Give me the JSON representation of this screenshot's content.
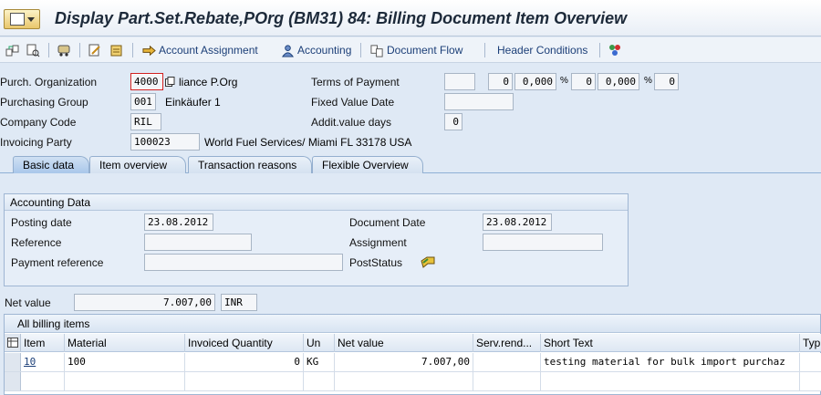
{
  "window": {
    "title": "Display Part.Set.Rebate,POrg (BM31) 84: Billing Document Item Overview"
  },
  "toolbar": {
    "account_assignment": "Account Assignment",
    "accounting": "Accounting",
    "document_flow": "Document Flow",
    "header_conditions": "Header Conditions"
  },
  "header": {
    "purch_org_label": "Purch. Organization",
    "purch_org_value": "4000",
    "purch_org_text": "liance  P.Org",
    "purch_group_label": "Purchasing Group",
    "purch_group_value": "001",
    "purch_group_text": "Einkäufer 1",
    "company_code_label": "Company Code",
    "company_code_value": "RIL",
    "invoicing_party_label": "Invoicing Party",
    "invoicing_party_value": "100023",
    "invoicing_party_text": "World Fuel Services/ Miami FL  33178 USA",
    "terms_label": "Terms of Payment",
    "terms_value": "",
    "terms_days1": "0",
    "terms_pct1": "0,000",
    "terms_days2": "0",
    "terms_pct2": "0,000",
    "terms_days3": "0",
    "pct_sign": "%",
    "fixed_value_date_label": "Fixed Value Date",
    "fixed_value_date_value": "",
    "addit_value_days_label": "Addit.value days",
    "addit_value_days_value": "0"
  },
  "tabs": [
    {
      "label": "Basic data",
      "active": true
    },
    {
      "label": "Item overview",
      "active": false
    },
    {
      "label": "Transaction reasons",
      "active": false
    },
    {
      "label": "Flexible Overview",
      "active": false
    }
  ],
  "accounting": {
    "title": "Accounting Data",
    "posting_date_label": "Posting date",
    "posting_date_value": "23.08.2012",
    "document_date_label": "Document Date",
    "document_date_value": "23.08.2012",
    "reference_label": "Reference",
    "reference_value": "",
    "assignment_label": "Assignment",
    "assignment_value": "",
    "payment_reference_label": "Payment reference",
    "payment_reference_value": "",
    "post_status_label": "PostStatus"
  },
  "net_value": {
    "label": "Net value",
    "value": "7.007,00",
    "currency": "INR"
  },
  "billing_items": {
    "caption": "All billing items",
    "columns": [
      "Item",
      "Material",
      "Invoiced Quantity",
      "Un",
      "Net value",
      "Serv.rend...",
      "Short Text",
      "Typ"
    ],
    "rows": [
      {
        "item": "10",
        "material": "100",
        "qty": "0",
        "unit": "KG",
        "net_value": "7.007,00",
        "serv": "",
        "short_text": "testing material for bulk import purchaz",
        "typ": ""
      }
    ]
  },
  "colors": {
    "background": "#dfe9f5",
    "link": "#1c3f78",
    "focus_border": "#d02020"
  }
}
